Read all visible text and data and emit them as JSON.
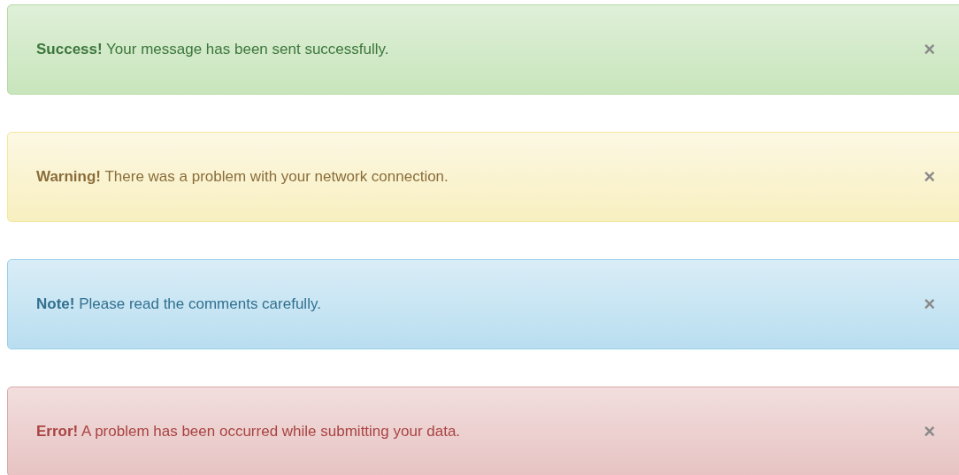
{
  "alerts": [
    {
      "kind": "success",
      "text": "**Success!** Your message has been sent successfully.",
      "close": "×"
    },
    {
      "kind": "warning",
      "text": "**Warning!** There was a problem with your network connection.",
      "close": "×"
    },
    {
      "kind": "info",
      "text": "**Note!** Please read the comments carefully.",
      "close": "×"
    },
    {
      "kind": "danger",
      "text": "**Error!** A problem has been occurred while submitting your data.",
      "close": "×"
    }
  ]
}
